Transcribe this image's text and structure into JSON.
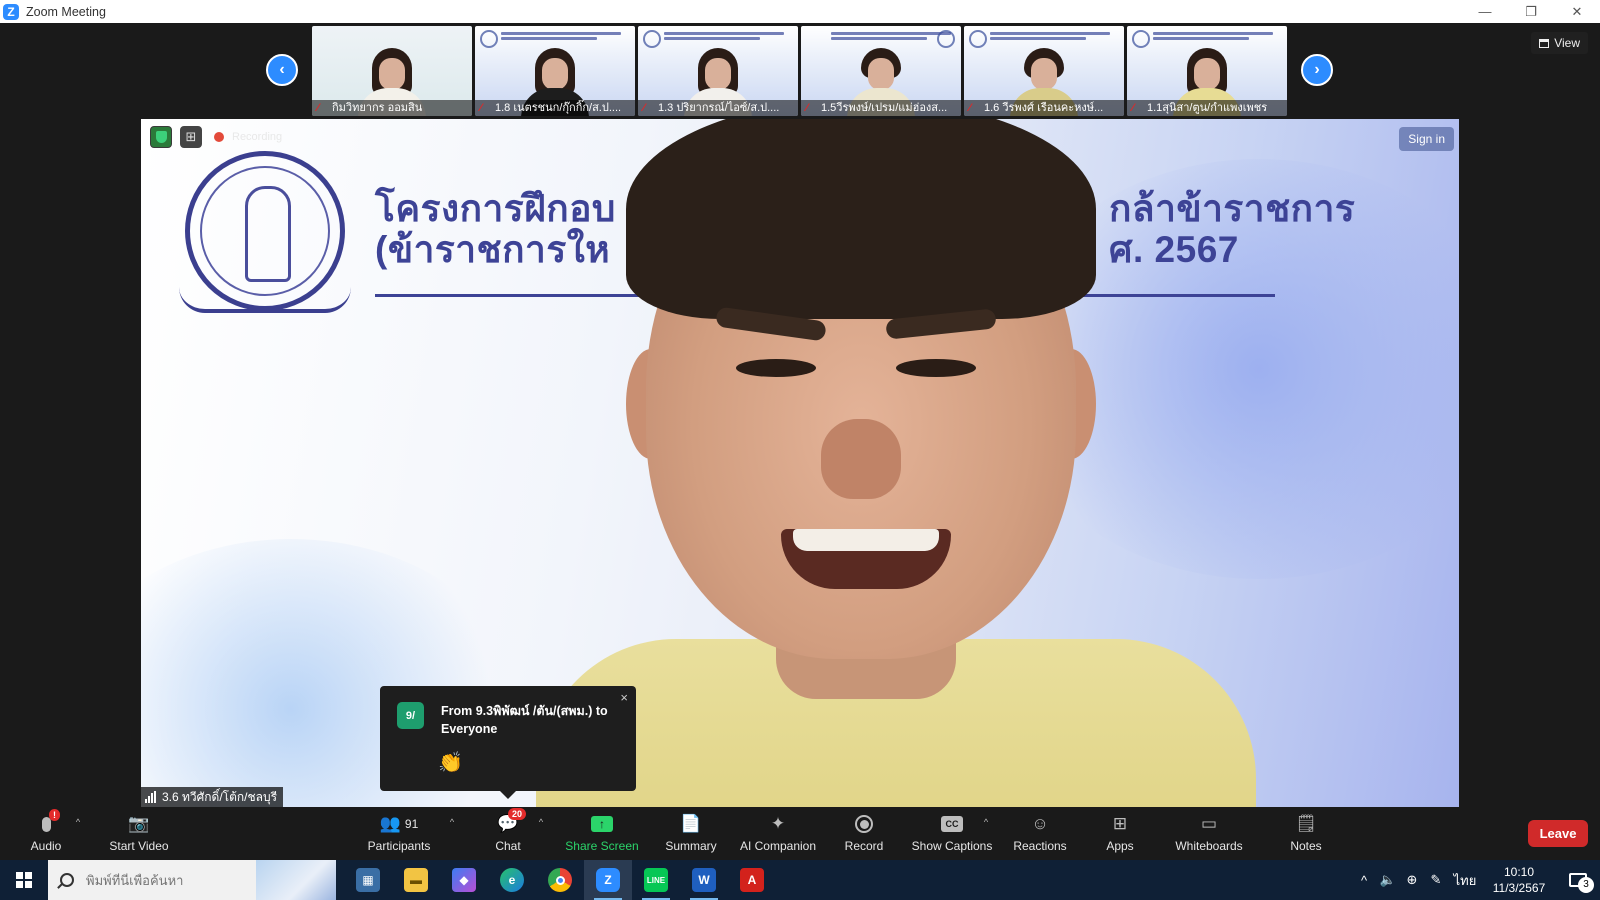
{
  "window": {
    "title": "Zoom Meeting",
    "logo_letter": "Z"
  },
  "view_button": {
    "label": "View"
  },
  "thumbnails": [
    {
      "name": "กิมวิทยากร ออมสิน",
      "bg": "white",
      "shirt": "#f3f1ea"
    },
    {
      "name": "1.8 เนตรชนก/กุ๊กกิ๊ก/ส.ป....",
      "bg": "blue",
      "shirt": "#1d1d1d"
    },
    {
      "name": "1.3 ปริยากรณ์/ไอซ์/ส.ป....",
      "bg": "blue",
      "shirt": "#f2f0ec"
    },
    {
      "name": "1.5วีรพงษ์/เปรม/แม่ฮ่องส...",
      "bg": "blue",
      "shirt": "#ece6cf"
    },
    {
      "name": "1.6 วีรพงศ์ เรือนคะหงษ์...",
      "bg": "blue",
      "shirt": "#d9cc8a"
    },
    {
      "name": "1.1สุนิสา/ตูน/กำแพงเพชร",
      "bg": "blue",
      "shirt": "#e7dc94"
    }
  ],
  "slide": {
    "title_left_1": "โครงการฝึกอบ",
    "title_left_2": "(ข้าราชการให",
    "title_right_1": "กล้าข้าราชการ",
    "title_right_2": "ศ. 2567"
  },
  "recording": {
    "label": "Recording"
  },
  "sign_in": {
    "label": "Sign in"
  },
  "active_speaker": {
    "name": "3.6 ทวีศักดิ์/โต้ก/ชลบุรี"
  },
  "chat_popup": {
    "avatar": "9/",
    "from": "From 9.3พิพัฒน์ /ตัน/(สพม.) to Everyone",
    "message": "👏",
    "close": "×"
  },
  "toolbar": {
    "audio": "Audio",
    "audio_badge": "!",
    "start_video": "Start Video",
    "participants": "Participants",
    "participants_count": "91",
    "chat": "Chat",
    "chat_badge": "20",
    "share_screen": "Share Screen",
    "summary": "Summary",
    "ai_companion": "AI Companion",
    "record": "Record",
    "show_captions": "Show Captions",
    "cc": "CC",
    "reactions": "Reactions",
    "apps": "Apps",
    "whiteboards": "Whiteboards",
    "notes": "Notes",
    "leave": "Leave"
  },
  "taskbar": {
    "search_placeholder": "พิมพ์ที่นี่เพื่อค้นหา",
    "lang": "ไทย",
    "time": "10:10",
    "date": "11/3/2567",
    "notifications": "3"
  },
  "colors": {
    "zoom_blue": "#2d8cff",
    "leave_red": "#d02a2a",
    "share_green": "#2bd46a"
  }
}
